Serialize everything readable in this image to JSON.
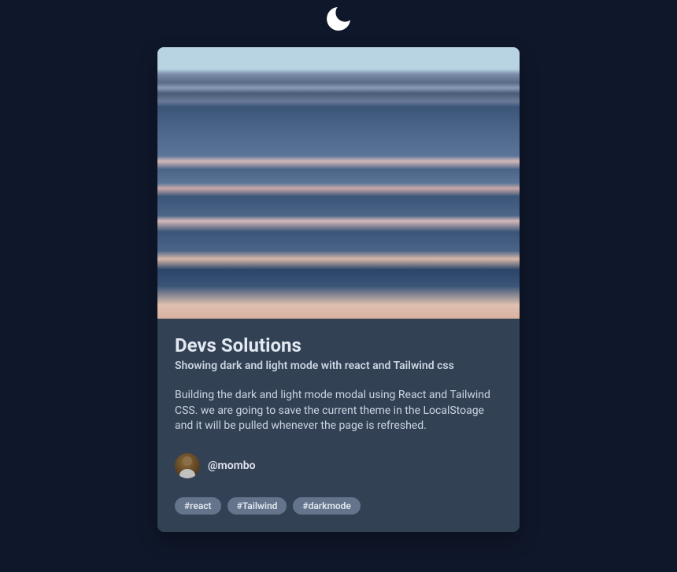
{
  "card": {
    "title": "Devs Solutions",
    "subtitle": "Showing dark and light mode with react and Tailwind css",
    "description": "Building the dark and light mode modal using React and Tailwind CSS. we are going to save the current theme in the LocalStoage and it will be pulled whenever the page is refreshed.",
    "author": {
      "handle": "@mombo"
    },
    "tags": [
      "#react",
      "#Tailwind",
      "#darkmode"
    ]
  }
}
